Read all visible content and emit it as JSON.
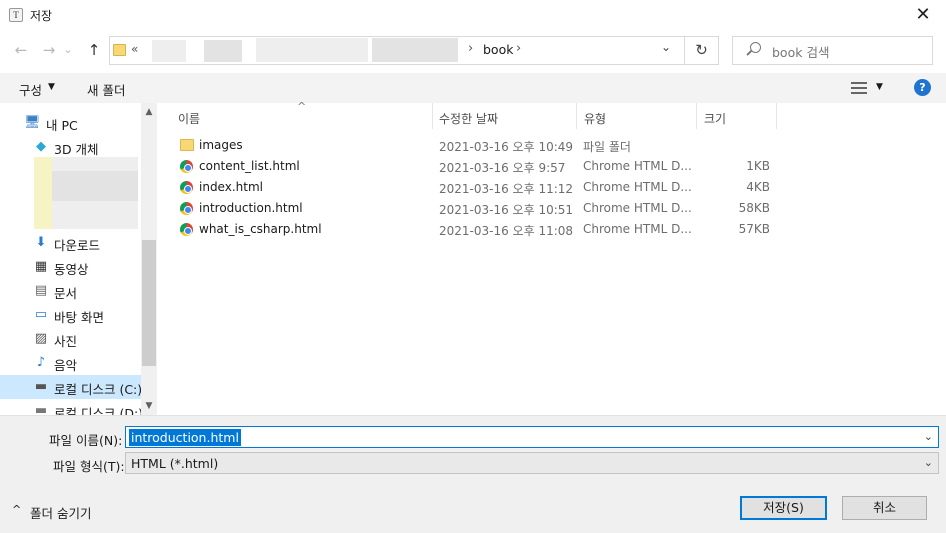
{
  "window": {
    "title": "저장",
    "app_icon_letter": "T",
    "close_glyph": "✕"
  },
  "navigation": {
    "back_glyph": "←",
    "forward_glyph": "→",
    "recent_glyph": "⌄",
    "up_glyph": "↑",
    "refresh_glyph": "↻"
  },
  "address": {
    "overflow_glyph": "«",
    "crumbs": [
      "book"
    ],
    "separator_glyph": "›",
    "dropdown_glyph": "⌄"
  },
  "search": {
    "placeholder": "book 검색"
  },
  "toolbar": {
    "organize_label": "구성",
    "organize_arrow": "▼",
    "new_folder_label": "새 폴더",
    "view_arrow": "▼",
    "help_glyph": "?"
  },
  "nav_pane": {
    "items": [
      {
        "label": "내 PC",
        "icon": "pc-icon",
        "glyph": "🖥"
      },
      {
        "label": "3D 개체",
        "icon": "3d-objects-icon",
        "glyph": "◆"
      },
      {
        "label": "다운로드",
        "icon": "download-icon",
        "glyph": "⬇"
      },
      {
        "label": "동영상",
        "icon": "video-icon",
        "glyph": "▦"
      },
      {
        "label": "문서",
        "icon": "document-icon",
        "glyph": "▤"
      },
      {
        "label": "바탕 화면",
        "icon": "desktop-icon",
        "glyph": "▭"
      },
      {
        "label": "사진",
        "icon": "pictures-icon",
        "glyph": "▨"
      },
      {
        "label": "음악",
        "icon": "music-icon",
        "glyph": "♪"
      },
      {
        "label": "로컬 디스크 (C:)",
        "icon": "drive-icon",
        "glyph": "▬"
      },
      {
        "label": "로컬 디스크 (D:)",
        "icon": "drive-icon",
        "glyph": "▬"
      }
    ],
    "scroll_up_glyph": "▲",
    "scroll_down_glyph": "▼"
  },
  "file_list": {
    "sort_glyph": "^",
    "columns": [
      "이름",
      "수정한 날짜",
      "유형",
      "크기"
    ],
    "rows": [
      {
        "name": "images",
        "date": "2021-03-16 오후 10:49",
        "type": "파일 폴더",
        "size": "",
        "icon": "folder-icon"
      },
      {
        "name": "content_list.html",
        "date": "2021-03-16 오후 9:57",
        "type": "Chrome HTML D...",
        "size": "1KB",
        "icon": "chrome-icon"
      },
      {
        "name": "index.html",
        "date": "2021-03-16 오후 11:12",
        "type": "Chrome HTML D...",
        "size": "4KB",
        "icon": "chrome-icon"
      },
      {
        "name": "introduction.html",
        "date": "2021-03-16 오후 10:51",
        "type": "Chrome HTML D...",
        "size": "58KB",
        "icon": "chrome-icon"
      },
      {
        "name": "what_is_csharp.html",
        "date": "2021-03-16 오후 11:08",
        "type": "Chrome HTML D...",
        "size": "57KB",
        "icon": "chrome-icon"
      }
    ]
  },
  "form": {
    "filename_label": "파일 이름(N):",
    "filename_value": "introduction.html",
    "filetype_label": "파일 형식(T):",
    "filetype_value": "HTML (*.html)",
    "dropdown_glyph": "⌄",
    "save_label": "저장(S)",
    "cancel_label": "취소",
    "hide_folders_glyph": "^",
    "hide_folders_label": "폴더 숨기기"
  },
  "colors": {
    "accent": "#0078d7",
    "selection": "#cce8ff",
    "help": "#1f74d1"
  }
}
